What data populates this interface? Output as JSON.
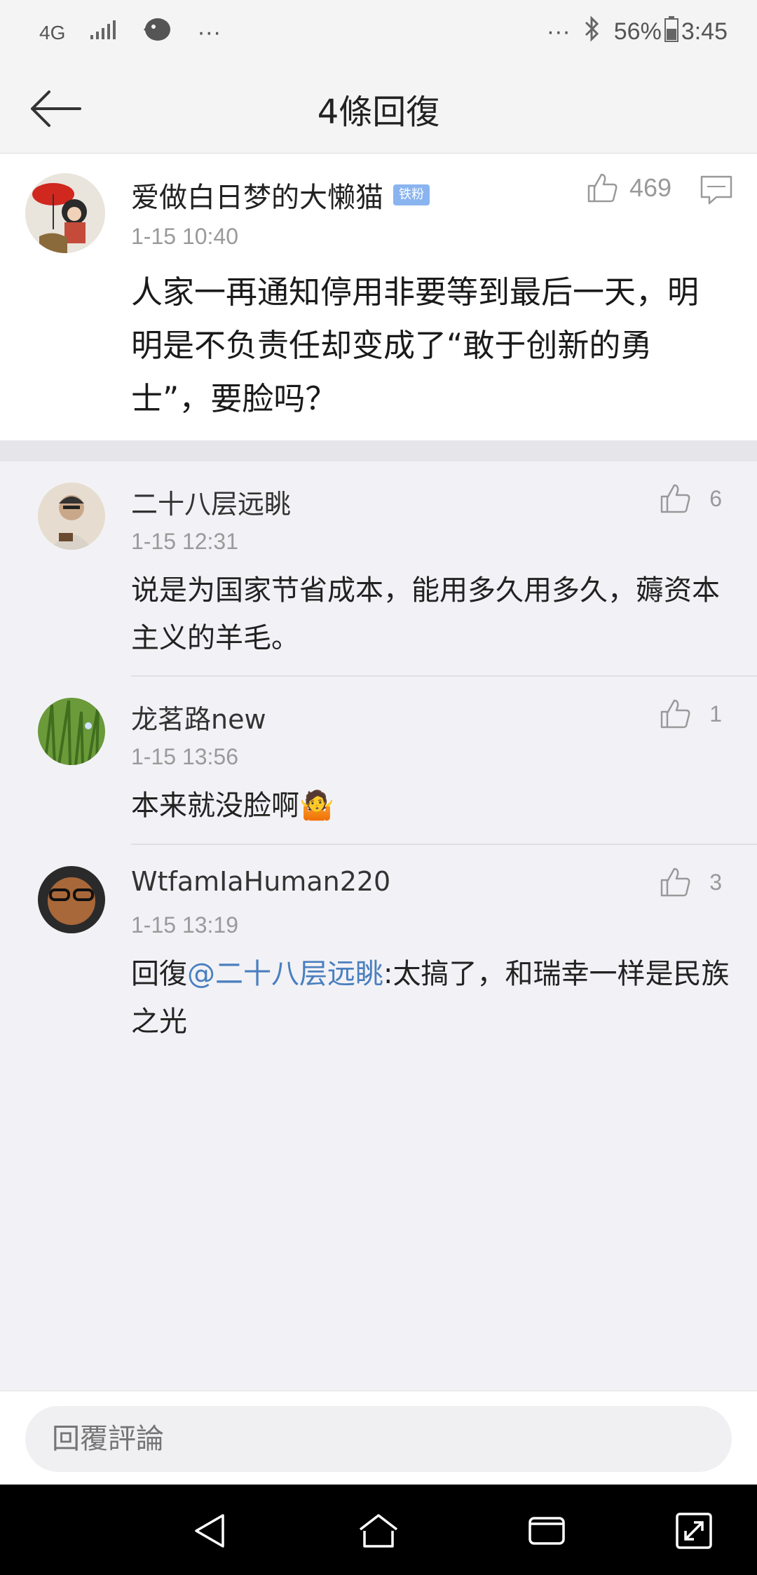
{
  "status_bar": {
    "network": "4G",
    "extra": "···",
    "extra_right": "···",
    "battery_percent": "56%",
    "time": "3:45"
  },
  "header": {
    "title": "4條回復",
    "back_icon": "arrow-left-icon"
  },
  "main_comment": {
    "author": "爱做白日梦的大懒猫",
    "badge": "铁粉",
    "time": "1-15 10:40",
    "likes": "469",
    "text": "人家一再通知停用非要等到最后一天，明明是不负责任却变成了“敢于创新的勇士”，要脸吗？"
  },
  "replies": [
    {
      "author": "二十八层远眺",
      "time": "1-15 12:31",
      "likes": "6",
      "text": "说是为国家节省成本，能用多久用多久，薅资本主义的羊毛。"
    },
    {
      "author": "龙茗路new",
      "time": "1-15 13:56",
      "likes": "1",
      "text": "本来就没脸啊",
      "emoji": "🤷"
    },
    {
      "author": "WtfamIaHuman220",
      "time": "1-15 13:19",
      "likes": "3",
      "reply_prefix": "回復",
      "mention": "@二十八层远眺",
      "text": ":太搞了，和瑞幸一样是民族之光"
    }
  ],
  "input": {
    "placeholder": "回覆評論"
  },
  "colors": {
    "mention": "#4a7fbf",
    "badge": "#8ab4f0",
    "background": "#f2f2f6"
  }
}
